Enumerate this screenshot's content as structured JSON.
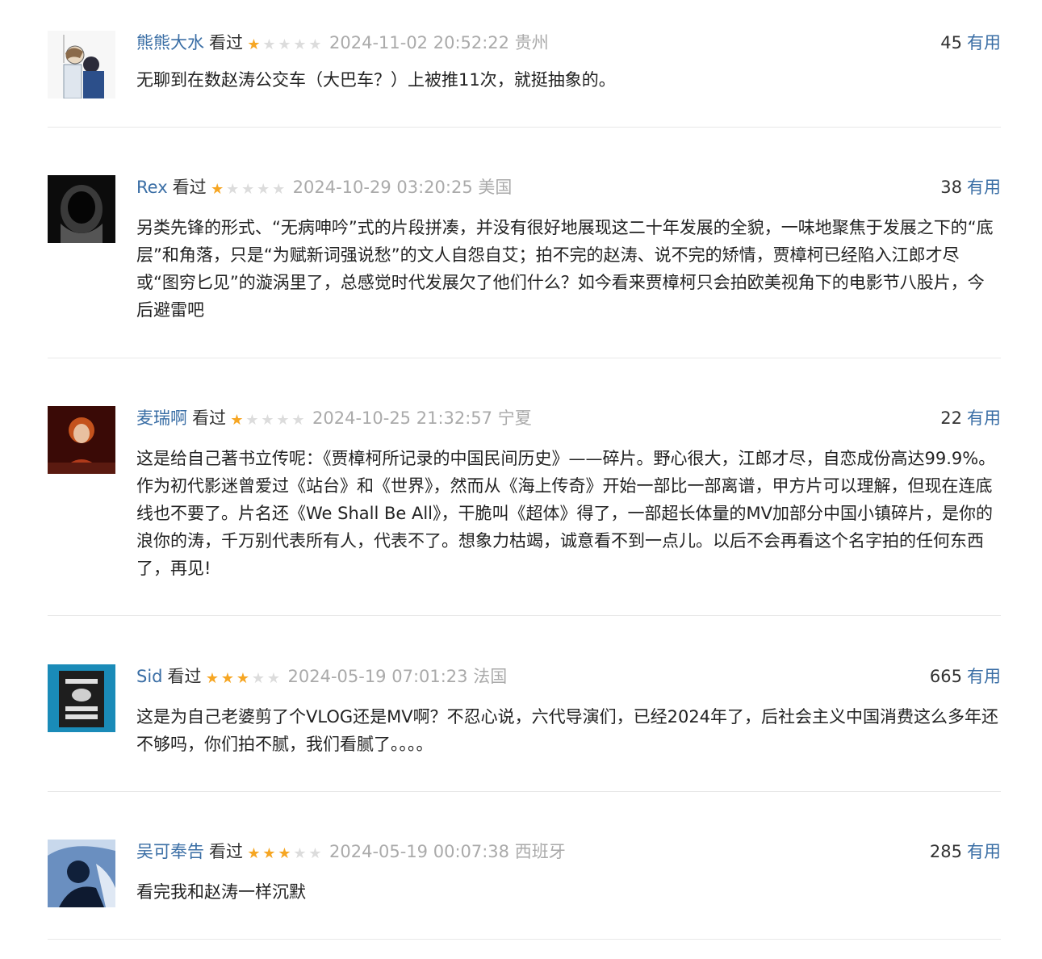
{
  "comments": [
    {
      "user": "熊熊大水",
      "status": "看过",
      "rating": 1,
      "time": "2024-11-02 20:52:22 贵州",
      "votes": "45",
      "useful": "有用",
      "text": "无聊到在数赵涛公交车（大巴车？）上被推11次，就挺抽象的。"
    },
    {
      "user": "Rex",
      "status": "看过",
      "rating": 1,
      "time": "2024-10-29 03:20:25 美国",
      "votes": "38",
      "useful": "有用",
      "text": "另类先锋的形式、“无病呻吟”式的片段拼凑，并没有很好地展现这二十年发展的全貌，一味地聚焦于发展之下的“底层”和角落，只是“为赋新词强说愁”的文人自怨自艾；拍不完的赵涛、说不完的矫情，贾樟柯已经陷入江郎才尽或“图穷匕见”的漩涡里了，总感觉时代发展欠了他们什么？如今看来贾樟柯只会拍欧美视角下的电影节八股片，今后避雷吧"
    },
    {
      "user": "麦瑞啊",
      "status": "看过",
      "rating": 1,
      "time": "2024-10-25 21:32:57 宁夏",
      "votes": "22",
      "useful": "有用",
      "text": "这是给自己著书立传呢：《贾樟柯所记录的中国民间历史》——碎片。野心很大，江郎才尽，自恋成份高达99.9%。作为初代影迷曾爱过《站台》和《世界》，然而从《海上传奇》开始一部比一部离谱，甲方片可以理解，但现在连底线也不要了。片名还《We Shall Be All》，干脆叫《超体》得了，一部超长体量的MV加部分中国小镇碎片，是你的浪你的涛，千万别代表所有人，代表不了。想象力枯竭，诚意看不到一点儿。以后不会再看这个名字拍的任何东西了，再见!"
    },
    {
      "user": "Sid",
      "status": "看过",
      "rating": 3,
      "time": "2024-05-19 07:01:23 法国",
      "votes": "665",
      "useful": "有用",
      "text": "这是为自己老婆剪了个VLOG还是MV啊？不忍心说，六代导演们，已经2024年了，后社会主义中国消费这么多年还不够吗，你们拍不腻，我们看腻了。。。。"
    },
    {
      "user": "吴可奉告",
      "status": "看过",
      "rating": 3,
      "time": "2024-05-19 00:07:38 西班牙",
      "votes": "285",
      "useful": "有用",
      "text": "看完我和赵涛一样沉默"
    }
  ],
  "avatar_icons": [
    "sketch-two-people-icon",
    "astronaut-helmet-icon",
    "red-hair-woman-icon",
    "queer-utopias-book-icon",
    "blue-figure-icon"
  ],
  "colors": {
    "link": "#3a6ea5",
    "star_on": "#f6a623",
    "star_off": "#dcdcdc",
    "muted": "#aaaaaa"
  }
}
